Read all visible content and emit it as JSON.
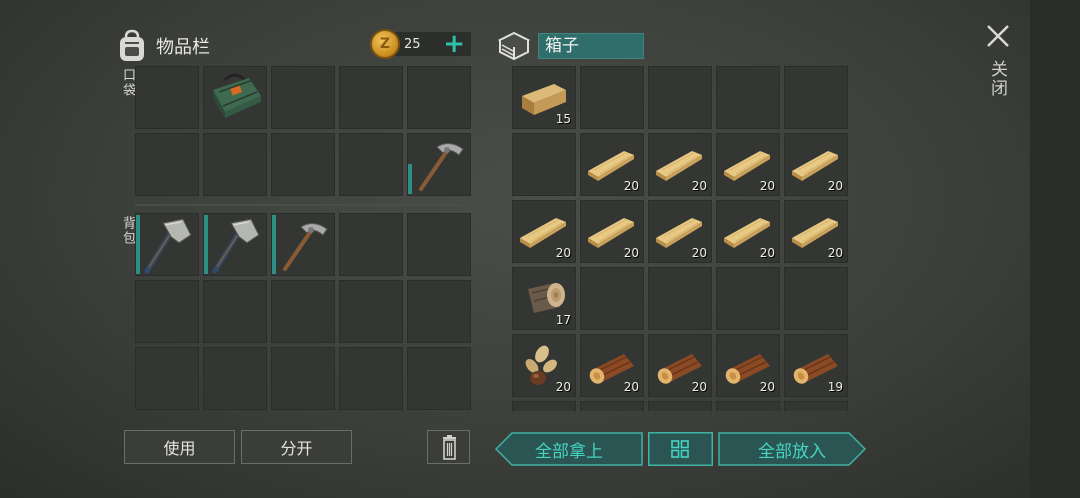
{
  "inventory": {
    "title": "物品栏",
    "pocket_label": "口袋",
    "backpack_label": "背包",
    "coins": "25",
    "coin_symbol": "Z",
    "add_coins_symbol": "+",
    "pockets": [
      {
        "item": null
      },
      {
        "item": "green-bag"
      },
      {
        "item": null
      },
      {
        "item": null
      },
      {
        "item": null
      },
      {
        "item": null
      },
      {
        "item": null
      },
      {
        "item": null
      },
      {
        "item": null
      },
      {
        "item": "pickaxe",
        "durability": 0.5
      }
    ],
    "backpack": [
      {
        "item": "stone-axe",
        "durability": 1.0
      },
      {
        "item": "stone-axe",
        "durability": 1.0
      },
      {
        "item": "pickaxe",
        "durability": 1.0
      },
      {
        "item": null
      },
      {
        "item": null
      },
      {
        "item": null
      },
      {
        "item": null
      },
      {
        "item": null
      },
      {
        "item": null
      },
      {
        "item": null
      },
      {
        "item": null
      },
      {
        "item": null
      },
      {
        "item": null
      },
      {
        "item": null
      },
      {
        "item": null
      }
    ]
  },
  "box": {
    "title": "箱子",
    "slots": [
      {
        "item": "wood-block",
        "qty": "15"
      },
      {
        "item": null
      },
      {
        "item": null
      },
      {
        "item": null
      },
      {
        "item": null
      },
      {
        "item": null
      },
      {
        "item": "plank",
        "qty": "20"
      },
      {
        "item": "plank",
        "qty": "20"
      },
      {
        "item": "plank",
        "qty": "20"
      },
      {
        "item": "plank",
        "qty": "20"
      },
      {
        "item": "plank",
        "qty": "20"
      },
      {
        "item": "plank",
        "qty": "20"
      },
      {
        "item": "plank",
        "qty": "20"
      },
      {
        "item": "plank",
        "qty": "20"
      },
      {
        "item": "plank",
        "qty": "20"
      },
      {
        "item": "log-end",
        "qty": "17"
      },
      {
        "item": null
      },
      {
        "item": null
      },
      {
        "item": null
      },
      {
        "item": null
      },
      {
        "item": "seeds",
        "qty": "20"
      },
      {
        "item": "log",
        "qty": "20"
      },
      {
        "item": "log",
        "qty": "20"
      },
      {
        "item": "log",
        "qty": "20"
      },
      {
        "item": "log",
        "qty": "19"
      },
      {
        "item": null
      },
      {
        "item": null
      },
      {
        "item": null
      },
      {
        "item": null
      },
      {
        "item": null
      }
    ]
  },
  "actions": {
    "use": "使用",
    "split": "分开",
    "take_all": "全部拿上",
    "put_all": "全部放入",
    "close": "关闭"
  },
  "colors": {
    "accent": "#47d4c2",
    "durability": "#2e8f86",
    "name_field": "#2f6e6b"
  }
}
